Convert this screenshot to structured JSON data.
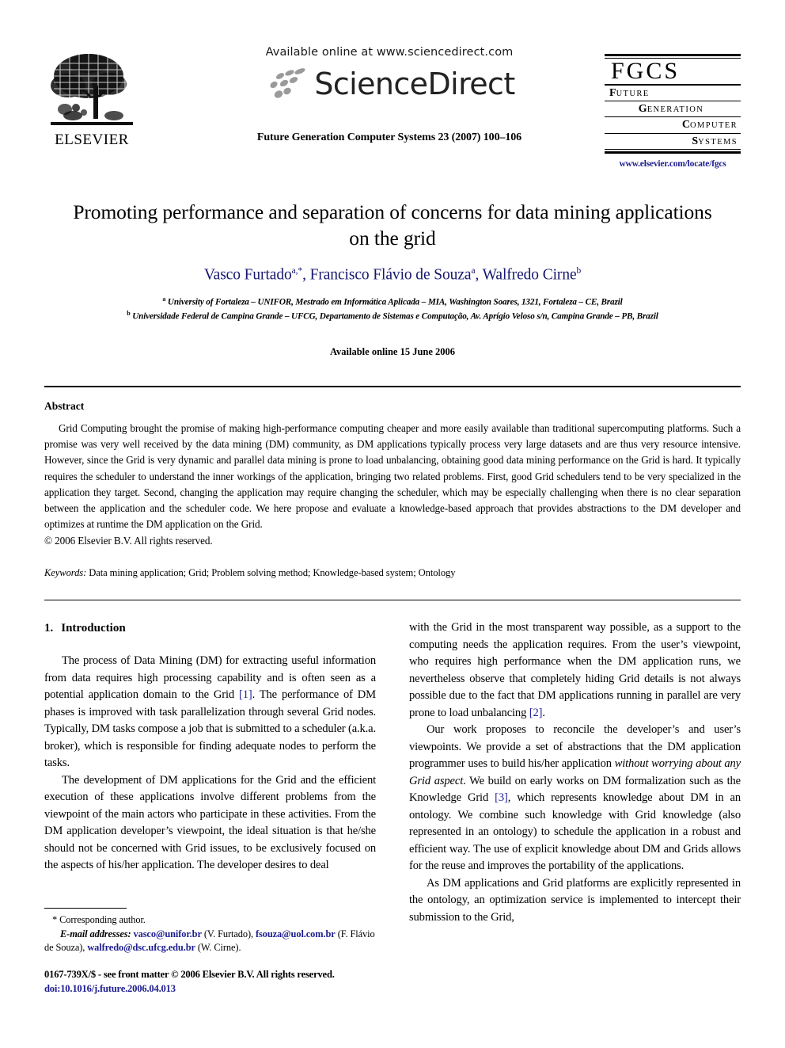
{
  "header": {
    "publisher_name": "ELSEVIER",
    "available_online_at": "Available online at www.sciencedirect.com",
    "sciencedirect_wordmark": "ScienceDirect",
    "journal_reference": "Future Generation Computer Systems 23 (2007) 100–106",
    "journal_logo": {
      "acronym": "FGCS",
      "line1_cap": "F",
      "line1_rest": "UTURE",
      "line2_cap": "G",
      "line2_rest": "ENERATION",
      "line3_cap": "C",
      "line3_rest": "OMPUTER",
      "line4_cap": "S",
      "line4_rest": "YSTEMS",
      "url": "www.elsevier.com/locate/fgcs"
    }
  },
  "article": {
    "title": "Promoting performance and separation of concerns for data mining applications on the grid",
    "authors_html": "Vasco Furtado<sup>a,*</sup>, Francisco Flávio de Souza<sup>a</sup>, Walfredo Cirne<sup>b</sup>",
    "affiliation_a": "University of Fortaleza – UNIFOR, Mestrado em Informática Aplicada – MIA, Washington Soares, 1321, Fortaleza – CE, Brazil",
    "affiliation_b": "Universidade Federal de Campina Grande – UFCG, Departamento de Sistemas e Computação, Av. Aprígio Veloso s/n, Campina Grande – PB, Brazil",
    "available_online_date": "Available online 15 June 2006"
  },
  "abstract": {
    "heading": "Abstract",
    "paragraph": "Grid Computing brought the promise of making high-performance computing cheaper and more easily available than traditional supercomputing platforms. Such a promise was very well received by the data mining (DM) community, as DM applications typically process very large datasets and are thus very resource intensive. However, since the Grid is very dynamic and parallel data mining is prone to load unbalancing, obtaining good data mining performance on the Grid is hard. It typically requires the scheduler to understand the inner workings of the application, bringing two related problems. First, good Grid schedulers tend to be very specialized in the application they target. Second, changing the application may require changing the scheduler, which may be especially challenging when there is no clear separation between the application and the scheduler code. We here propose and evaluate a knowledge-based approach that provides abstractions to the DM developer and optimizes at runtime the DM application on the Grid.",
    "copyright": "© 2006 Elsevier B.V. All rights reserved.",
    "keywords_label": "Keywords:",
    "keywords_value": "Data mining application; Grid; Problem solving method; Knowledge-based system; Ontology"
  },
  "body": {
    "section_number": "1.",
    "section_title": "Introduction",
    "left_p1_a": "The process of Data Mining (DM) for extracting useful information from data requires high processing capability and is often seen as a potential application domain to the Grid ",
    "left_p1_cite": "[1]",
    "left_p1_b": ". The performance of DM phases is improved with task parallelization through several Grid nodes. Typically, DM tasks compose a job that is submitted to a scheduler (a.k.a. broker), which is responsible for finding adequate nodes to perform the tasks.",
    "left_p2": "The development of DM applications for the Grid and the efficient execution of these applications involve different problems from the viewpoint of the main actors who participate in these activities. From the DM application developer’s viewpoint, the ideal situation is that he/she should not be concerned with Grid issues, to be exclusively focused on the aspects of his/her application. The developer desires to deal",
    "right_p1_a": "with the Grid in the most transparent way possible, as a support to the computing needs the application requires. From the user’s viewpoint, who requires high performance when the DM application runs, we nevertheless observe that completely hiding Grid details is not always possible due to the fact that DM applications running in parallel are very prone to load unbalancing ",
    "right_p1_cite": "[2]",
    "right_p1_b": ".",
    "right_p2_a": "Our work proposes to reconcile the developer’s and user’s viewpoints. We provide a set of abstractions that the DM application programmer uses to build his/her application ",
    "right_p2_italic": "without worrying about any Grid aspect",
    "right_p2_b": ". We build on early works on DM formalization such as the Knowledge Grid ",
    "right_p2_cite": "[3]",
    "right_p2_c": ", which represents knowledge about DM in an ontology. We combine such knowledge with Grid knowledge (also represented in an ontology) to schedule the application in a robust and efficient way. The use of explicit knowledge about DM and Grids allows for the reuse and improves the portability of the applications.",
    "right_p3": "As DM applications and Grid platforms are explicitly represented in the ontology, an optimization service is implemented to intercept their submission to the Grid,"
  },
  "footnote": {
    "corresponding": "* Corresponding author.",
    "email_label": "E-mail addresses:",
    "email1": "vasco@unifor.br",
    "email1_owner": "(V. Furtado),",
    "email2": "fsouza@uol.com.br",
    "email2_owner": "(F. Flávio de Souza),",
    "email3": "walfredo@dsc.ufcg.edu.br",
    "email3_owner": "(W. Cirne)."
  },
  "page_footer": {
    "issn_line": "0167-739X/$ - see front matter © 2006 Elsevier B.V. All rights reserved.",
    "doi": "doi:10.1016/j.future.2006.04.013"
  },
  "colors": {
    "author_blue": "#16166e",
    "link_blue": "#1d1d8f",
    "citation_blue": "#23239c"
  }
}
